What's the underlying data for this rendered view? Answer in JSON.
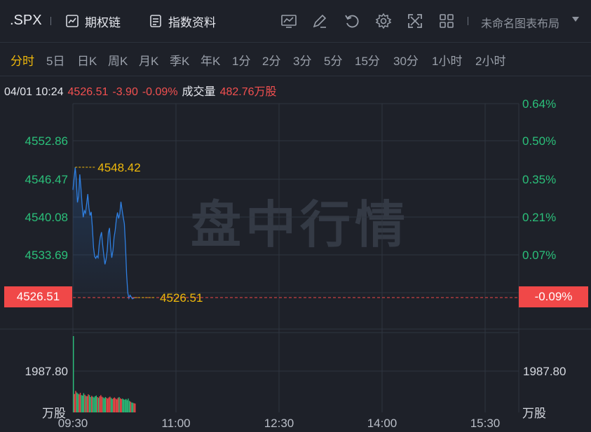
{
  "toolbar": {
    "symbol": ".SPX",
    "options_chain": "期权链",
    "index_info": "指数资料",
    "layout_name": "未命名图表布局",
    "icons": [
      "chart-draw-icon",
      "edit-icon",
      "reset-icon",
      "settings-icon",
      "fullscreen-icon",
      "grid-layout-icon"
    ]
  },
  "periods": [
    "分时",
    "5日",
    "日K",
    "周K",
    "月K",
    "季K",
    "年K",
    "1分",
    "2分",
    "3分",
    "5分",
    "15分",
    "30分",
    "1小时",
    "2小时"
  ],
  "active_period": "分时",
  "quote": {
    "datetime": "04/01 10:24",
    "price": "4526.51",
    "change": "-3.90",
    "change_pct": "-0.09%",
    "volume_label": "成交量",
    "volume": "482.76万股"
  },
  "watermark": "盘中行情",
  "colors": {
    "price_line": "#2f7fe0",
    "up": "#f04848",
    "down": "#2bc07a",
    "accent": "#f0b90b"
  },
  "chart_data": {
    "type": "line",
    "price_ticks": [
      "4552.86",
      "4546.47",
      "4540.08",
      "4533.69"
    ],
    "pct_ticks": [
      "0.64%",
      "0.50%",
      "0.35%",
      "0.21%",
      "0.07%"
    ],
    "current_price_label": "4526.51",
    "current_pct_label": "-0.09%",
    "high_label": "4548.42",
    "last_label": "4526.51",
    "volume_tick": "1987.80",
    "volume_unit": "万股",
    "time_ticks": [
      "09:30",
      "11:00",
      "12:30",
      "14:00",
      "15:30"
    ],
    "x_minutes": [
      0,
      1,
      2,
      3,
      4,
      5,
      6,
      7,
      8,
      9,
      10,
      11,
      12,
      13,
      14,
      15,
      16,
      17,
      18,
      19,
      20,
      21,
      22,
      23,
      24,
      25,
      26,
      27,
      28,
      29,
      30,
      31,
      32,
      33,
      34,
      35,
      36,
      37,
      38,
      39,
      40,
      41,
      42,
      43,
      44,
      45,
      46,
      47,
      48,
      49,
      50,
      51,
      52,
      53,
      54
    ],
    "prices": [
      4544.6,
      4546.5,
      4548.4,
      4546.2,
      4542.5,
      4543.6,
      4547.2,
      4545.0,
      4542.3,
      4540.0,
      4541.1,
      4540.7,
      4542.3,
      4543.9,
      4541.6,
      4540.3,
      4540.9,
      4538.4,
      4534.9,
      4533.4,
      4533.1,
      4533.5,
      4533.2,
      4535.4,
      4536.7,
      4537.5,
      4535.4,
      4533.7,
      4532.1,
      4532.9,
      4534.4,
      4537.4,
      4538.2,
      4535.0,
      4533.2,
      4534.4,
      4536.6,
      4537.8,
      4539.7,
      4540.8,
      4539.8,
      4540.6,
      4542.6,
      4541.3,
      4540.0,
      4538.9,
      4535.2,
      4530.4,
      4527.3,
      4526.4,
      4526.9,
      4526.6,
      4526.3,
      4526.4,
      4526.51
    ],
    "volumes": [
      1990,
      480,
      560,
      520,
      490,
      470,
      510,
      450,
      440,
      500,
      460,
      430,
      420,
      470,
      450,
      400,
      430,
      410,
      390,
      420,
      440,
      400,
      380,
      420,
      450,
      410,
      390,
      370,
      400,
      380,
      360,
      390,
      410,
      380,
      350,
      370,
      390,
      360,
      340,
      380,
      400,
      370,
      350,
      360,
      340,
      330,
      350,
      320,
      360,
      300,
      280,
      260,
      250,
      240,
      230
    ],
    "session_start_minute": 0,
    "session_end_minute": 390,
    "y_price_range": [
      4526.51,
      4552.86
    ]
  }
}
